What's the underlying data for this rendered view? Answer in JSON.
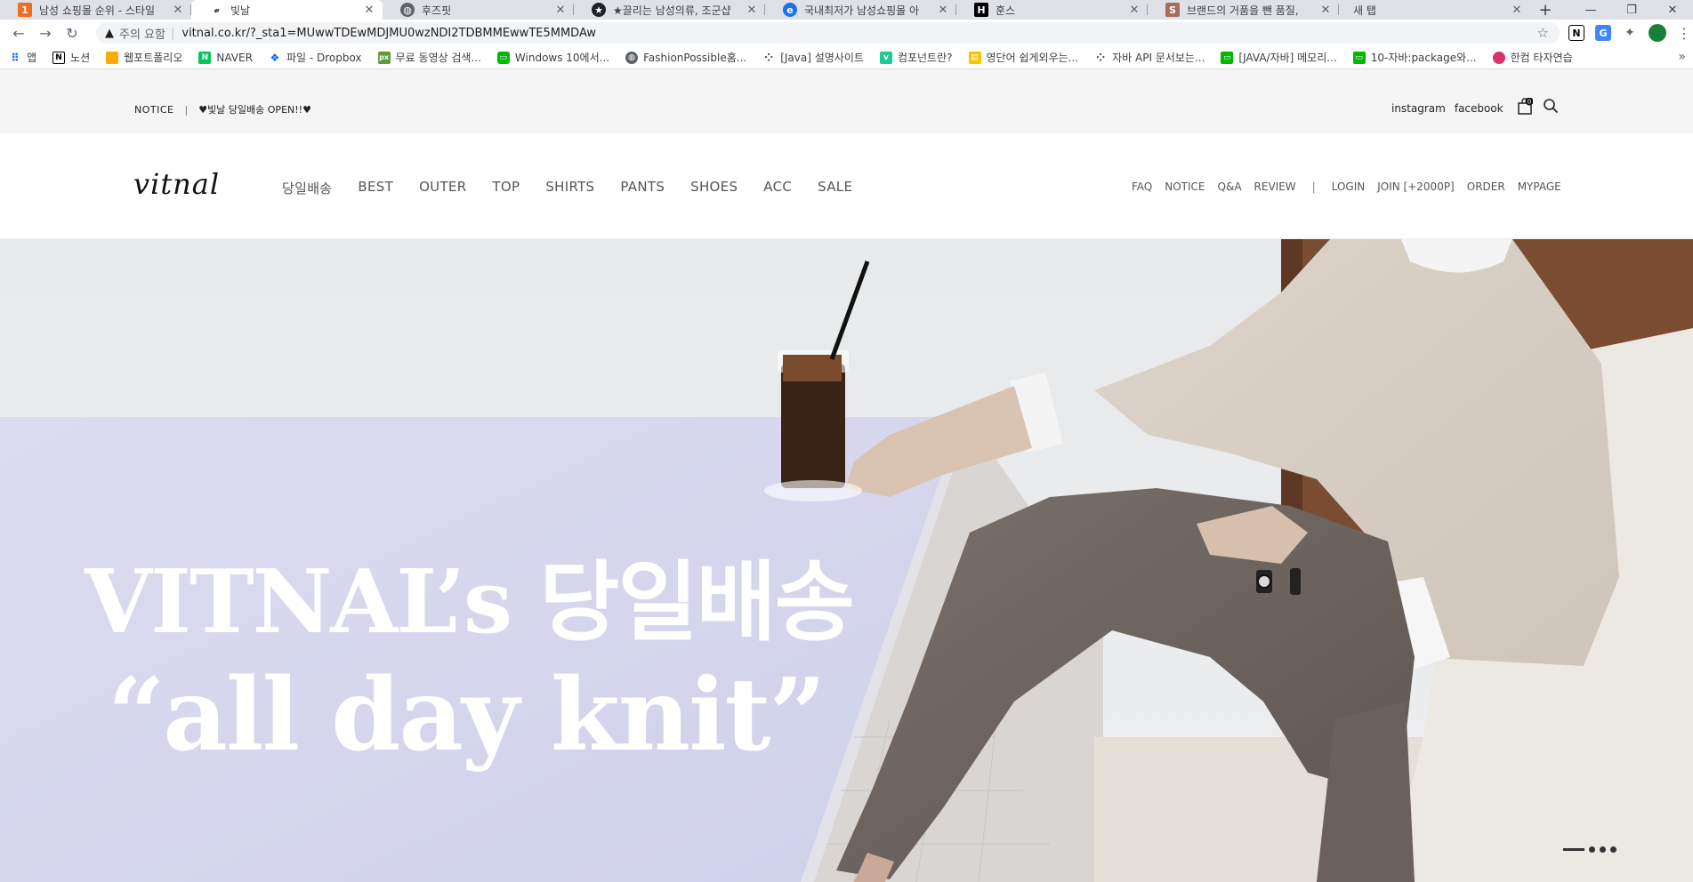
{
  "browser": {
    "tabs": [
      {
        "title": "남성 쇼핑몰 순위 - 스타일",
        "favicon": "1",
        "color": "#f36b21"
      },
      {
        "title": "빛날",
        "favicon": "V",
        "color": "#ffffff"
      },
      {
        "title": "후즈핏",
        "favicon": "globe-icon",
        "color": "#5f6368"
      },
      {
        "title": "★끌리는 남성의류, 조군샵",
        "favicon": "star-circle-icon",
        "color": "#202124"
      },
      {
        "title": "국내최저가 남성쇼핑몰 아",
        "favicon": "e",
        "color": "#1a73e8"
      },
      {
        "title": "훈스",
        "favicon": "H",
        "color": "#000000"
      },
      {
        "title": "브랜드의 거품을 뺀 품질,",
        "favicon": "S",
        "color": "#a56e5a"
      },
      {
        "title": "새 탭",
        "favicon": "",
        "color": ""
      }
    ],
    "new_tab_label": "+",
    "address": {
      "security_label": "주의 요함",
      "url": "vitnal.co.kr/?_sta1=MUwwTDEwMDJMU0wzNDI2TDBMMEwwTE5MMDAw"
    },
    "bookmarks": [
      {
        "label": "앱",
        "icon": "apps-grid-icon",
        "color": "#1a73e8"
      },
      {
        "label": "노션",
        "icon": "N",
        "color": "#000000"
      },
      {
        "label": "웹포트폴리오",
        "icon": "folder-icon",
        "color": "#f9ab00"
      },
      {
        "label": "NAVER",
        "icon": "N",
        "color": "#03c75a"
      },
      {
        "label": "파일 - Dropbox",
        "icon": "dropbox-icon",
        "color": "#0061ff"
      },
      {
        "label": "무료 동영상 검색...",
        "icon": "px",
        "color": "#5b9c3a"
      },
      {
        "label": "Windows 10에서...",
        "icon": "chat-icon",
        "color": "#00b900"
      },
      {
        "label": "FashionPossible홈...",
        "icon": "globe-icon",
        "color": "#5f6368"
      },
      {
        "label": "[Java] 설명사이트",
        "icon": "tistory-icon",
        "color": "#333333"
      },
      {
        "label": "컴포넌트란?",
        "icon": "v",
        "color": "#20c997"
      },
      {
        "label": "영단어 쉽게외우는...",
        "icon": "note-icon",
        "color": "#f5c400"
      },
      {
        "label": "자바 API 문서보는...",
        "icon": "tistory-icon",
        "color": "#333333"
      },
      {
        "label": "[JAVA/자바] 메모리...",
        "icon": "chat-icon",
        "color": "#00b900"
      },
      {
        "label": "10-자바:package와...",
        "icon": "chat-icon",
        "color": "#00b900"
      },
      {
        "label": "한컴 타자연습",
        "icon": "hancom-icon",
        "color": "#d6336c"
      }
    ]
  },
  "site": {
    "notice_label": "NOTICE",
    "notice_divider": "|",
    "notice_message": "♥빛날 당일배송 OPEN!!♥",
    "social": [
      "instagram",
      "facebook"
    ],
    "cart_count": "0",
    "logo": "vitnal",
    "main_nav": [
      "당일배송",
      "BEST",
      "OUTER",
      "TOP",
      "SHIRTS",
      "PANTS",
      "SHOES",
      "ACC",
      "SALE"
    ],
    "sub_nav_left": [
      "FAQ",
      "NOTICE",
      "Q&A",
      "REVIEW"
    ],
    "sub_nav_divider": "|",
    "sub_nav_right": [
      "LOGIN",
      "JOIN [+2000P]",
      "ORDER",
      "MYPAGE"
    ]
  },
  "hero": {
    "line1": "VITNAL’s 당일배송",
    "line2": "“all day knit”",
    "slides": 4,
    "active_slide": 1
  },
  "colors": {
    "topbar_bg": "#f5f5f5",
    "hero_text": "#ffffff",
    "sweater": "#d9d0c6",
    "pants": "#6e6560"
  }
}
